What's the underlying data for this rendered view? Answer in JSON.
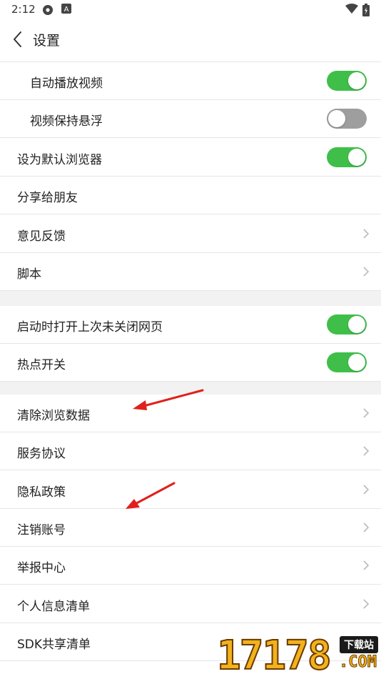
{
  "status_bar": {
    "time": "2:12",
    "icons": [
      "settings-gear-icon",
      "a-badge-icon",
      "wifi-icon",
      "battery-icon"
    ]
  },
  "header": {
    "title": "设置",
    "back_icon": "chevron-left-icon"
  },
  "settings": [
    {
      "label": "自动播放视频",
      "control": "toggle",
      "state": "on"
    },
    {
      "label": "视频保持悬浮",
      "control": "toggle",
      "state": "off"
    },
    {
      "label": "设为默认浏览器",
      "control": "toggle",
      "state": "on"
    },
    {
      "label": "分享给朋友",
      "control": "none"
    },
    {
      "label": "意见反馈",
      "control": "chevron"
    },
    {
      "label": "脚本",
      "control": "chevron"
    },
    {
      "label": "启动时打开上次未关闭网页",
      "control": "toggle",
      "state": "on"
    },
    {
      "label": "热点开关",
      "control": "toggle",
      "state": "on"
    },
    {
      "label": "清除浏览数据",
      "control": "chevron"
    },
    {
      "label": "服务协议",
      "control": "chevron"
    },
    {
      "label": "隐私政策",
      "control": "chevron"
    },
    {
      "label": "注销账号",
      "control": "chevron"
    },
    {
      "label": "举报中心",
      "control": "chevron"
    },
    {
      "label": "个人信息清单",
      "control": "chevron"
    },
    {
      "label": "SDK共享清单",
      "control": "chevron"
    }
  ],
  "colors": {
    "toggle_on": "#3fbf4a",
    "toggle_off": "#9e9e9e",
    "annotation_arrow": "#e0201c",
    "divider": "#e6e6e6",
    "section_gap": "#f2f2f2"
  },
  "watermark": {
    "digits": "17178",
    "badge": "下载站",
    "domain": ".COM"
  }
}
